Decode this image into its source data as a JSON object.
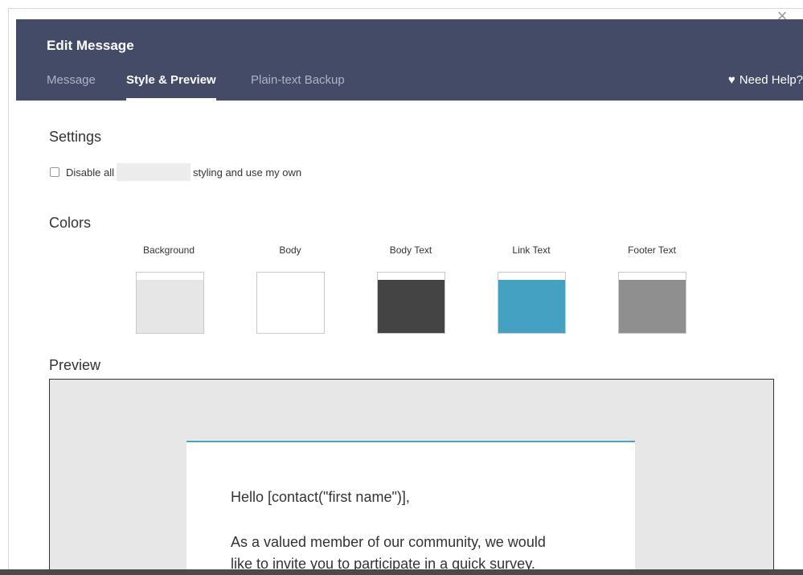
{
  "modal": {
    "title": "Edit Message",
    "tabs": [
      {
        "label": "Message",
        "active": false
      },
      {
        "label": "Style & Preview",
        "active": true
      },
      {
        "label": "Plain-text Backup",
        "active": false
      }
    ],
    "help_label": "Need Help?",
    "help_icon": "heart-icon"
  },
  "settings": {
    "title": "Settings",
    "checkbox_text_before": "Disable all",
    "checkbox_text_after": "styling and use my own",
    "checked": false
  },
  "colors": {
    "title": "Colors",
    "swatches": [
      {
        "label": "Background",
        "color": "#e6e6e6"
      },
      {
        "label": "Body",
        "color": "#ffffff"
      },
      {
        "label": "Body Text",
        "color": "#444444"
      },
      {
        "label": "Link Text",
        "color": "#45a1c2"
      },
      {
        "label": "Footer Text",
        "color": "#8f8f8f"
      }
    ]
  },
  "preview": {
    "title": "Preview",
    "greeting": "Hello [contact(\"first name\")],",
    "line1": "As a valued member of our community, we would",
    "line2": "like to invite you to participate in a quick survey."
  },
  "theme": {
    "header_bg": "#434b67",
    "accent": "#4aa3c3"
  }
}
